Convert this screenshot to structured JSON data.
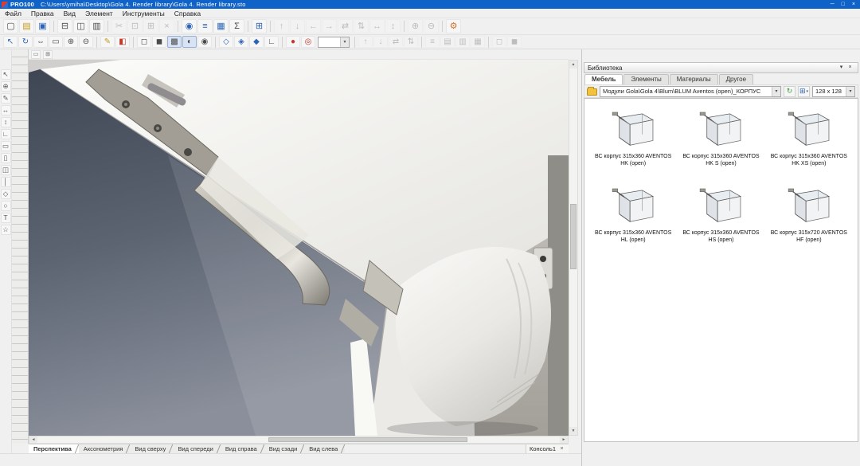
{
  "window": {
    "app_name": "PRO100",
    "file_path": "C:\\Users\\ymiha\\Desktop\\Gola 4. Render library\\Gola 4. Render library.sto",
    "minimize_glyph": "─",
    "maximize_glyph": "□",
    "close_glyph": "×"
  },
  "menu": {
    "items": [
      {
        "label": "Файл",
        "name": "menu-file"
      },
      {
        "label": "Правка",
        "name": "menu-edit"
      },
      {
        "label": "Вид",
        "name": "menu-view"
      },
      {
        "label": "Элемент",
        "name": "menu-element"
      },
      {
        "label": "Инструменты",
        "name": "menu-tools"
      },
      {
        "label": "Справка",
        "name": "menu-help"
      }
    ]
  },
  "toolbars": {
    "main": {
      "items": [
        {
          "name": "new-document-button",
          "glyph": "▢"
        },
        {
          "name": "open-button",
          "glyph": "▤",
          "cls": "c-yellow"
        },
        {
          "name": "save-button",
          "glyph": "▣",
          "cls": "c-blue"
        },
        {
          "name": "toolbar-separator",
          "cls": "sep",
          "interactable": false
        },
        {
          "name": "print-button",
          "glyph": "⊟"
        },
        {
          "name": "print-preview-button",
          "glyph": "◫"
        },
        {
          "name": "page-setup-button",
          "glyph": "▥"
        },
        {
          "name": "toolbar-separator",
          "cls": "sep",
          "interactable": false
        },
        {
          "name": "cut-button",
          "glyph": "✂",
          "cls": "disabled"
        },
        {
          "name": "copy-button",
          "glyph": "⊡",
          "cls": "disabled"
        },
        {
          "name": "paste-button",
          "glyph": "⊞",
          "cls": "disabled"
        },
        {
          "name": "delete-button",
          "glyph": "×",
          "cls": "disabled"
        },
        {
          "name": "toolbar-separator",
          "cls": "sep",
          "interactable": false
        },
        {
          "name": "update-library-button",
          "glyph": "◉",
          "cls": "c-blue"
        },
        {
          "name": "report-button",
          "glyph": "≡",
          "cls": "c-blue"
        },
        {
          "name": "price-list-button",
          "glyph": "▦",
          "cls": "c-blue"
        },
        {
          "name": "calculation-button",
          "glyph": "Σ"
        },
        {
          "name": "toolbar-separator",
          "cls": "sep",
          "interactable": false
        },
        {
          "name": "grid-button",
          "glyph": "⊞",
          "cls": "c-blue"
        },
        {
          "name": "toolbar-separator",
          "cls": "sep",
          "interactable": false
        },
        {
          "name": "align-top-button",
          "glyph": "↑",
          "cls": "disabled"
        },
        {
          "name": "align-bottom-button",
          "glyph": "↓",
          "cls": "disabled"
        },
        {
          "name": "align-left-button",
          "glyph": "←",
          "cls": "disabled"
        },
        {
          "name": "align-right-button",
          "glyph": "→",
          "cls": "disabled"
        },
        {
          "name": "center-horizontal-button",
          "glyph": "⇄",
          "cls": "disabled"
        },
        {
          "name": "center-vertical-button",
          "glyph": "⇅",
          "cls": "disabled"
        },
        {
          "name": "distribute-horizontal-button",
          "glyph": "↔",
          "cls": "disabled"
        },
        {
          "name": "distribute-vertical-button",
          "glyph": "↕",
          "cls": "disabled"
        },
        {
          "name": "toolbar-separator",
          "cls": "sep",
          "interactable": false
        },
        {
          "name": "group-button",
          "glyph": "⊕",
          "cls": "disabled"
        },
        {
          "name": "ungroup-button",
          "glyph": "⊖",
          "cls": "disabled"
        },
        {
          "name": "toolbar-separator",
          "cls": "sep",
          "interactable": false
        },
        {
          "name": "settings-button",
          "glyph": "⚙",
          "cls": "c-orange"
        }
      ]
    },
    "view": {
      "items_a": [
        {
          "name": "select-tool-button",
          "glyph": "↖",
          "cls": "c-blue"
        },
        {
          "name": "rotate-view-button",
          "glyph": "↻",
          "cls": "c-blue"
        },
        {
          "name": "pan-view-button",
          "glyph": "⇔"
        },
        {
          "name": "zoom-window-button",
          "glyph": "▭"
        },
        {
          "name": "zoom-in-button",
          "glyph": "⊕"
        },
        {
          "name": "zoom-out-button",
          "glyph": "⊖"
        },
        {
          "name": "toolbar-separator",
          "cls": "sep",
          "interactable": false
        },
        {
          "name": "edit-mode-button",
          "glyph": "✎",
          "cls": "c-yellow"
        },
        {
          "name": "material-mode-button",
          "glyph": "◧",
          "cls": "c-red"
        },
        {
          "name": "toolbar-separator",
          "cls": "sep",
          "interactable": false
        },
        {
          "name": "wireframe-mode-button",
          "glyph": "◻"
        },
        {
          "name": "solid-mode-button",
          "glyph": "◼"
        },
        {
          "name": "textured-mode-button",
          "glyph": "▩",
          "cls": "pressed"
        },
        {
          "name": "shadows-mode-button",
          "glyph": "◐",
          "cls": "pressed"
        },
        {
          "name": "visibility-button",
          "glyph": "◉"
        },
        {
          "name": "toolbar-separator",
          "cls": "sep",
          "interactable": false
        },
        {
          "name": "snap-grid-button",
          "glyph": "◇",
          "cls": "c-blue"
        },
        {
          "name": "snap-point-button",
          "glyph": "◈",
          "cls": "c-blue"
        },
        {
          "name": "snap-edge-button",
          "glyph": "◆",
          "cls": "c-blue"
        },
        {
          "name": "ortho-mode-button",
          "glyph": "∟"
        },
        {
          "name": "toolbar-separator",
          "cls": "sep",
          "interactable": false
        },
        {
          "name": "camera-button",
          "glyph": "●",
          "cls": "c-red"
        },
        {
          "name": "render-button",
          "glyph": "◎",
          "cls": "c-red"
        }
      ],
      "combobox": {
        "value": "",
        "arrow": "▾"
      },
      "items_b": [
        {
          "name": "toolbar-separator",
          "cls": "sep",
          "interactable": false
        },
        {
          "name": "move-up-button",
          "glyph": "↑",
          "cls": "disabled"
        },
        {
          "name": "move-down-button",
          "glyph": "↓",
          "cls": "disabled"
        },
        {
          "name": "flip-horizontal-button",
          "glyph": "⇄",
          "cls": "disabled"
        },
        {
          "name": "flip-vertical-button",
          "glyph": "⇅",
          "cls": "disabled"
        },
        {
          "name": "toolbar-separator",
          "cls": "sep",
          "interactable": false
        },
        {
          "name": "align-faces-button",
          "glyph": "≡",
          "cls": "disabled"
        },
        {
          "name": "fit-width-button",
          "glyph": "▤",
          "cls": "disabled"
        },
        {
          "name": "fit-height-button",
          "glyph": "▥",
          "cls": "disabled"
        },
        {
          "name": "fit-both-button",
          "glyph": "▦",
          "cls": "disabled"
        },
        {
          "name": "toolbar-separator",
          "cls": "sep",
          "interactable": false
        },
        {
          "name": "lock-button",
          "glyph": "◻",
          "cls": "disabled"
        },
        {
          "name": "unlock-button",
          "glyph": "◼",
          "cls": "disabled"
        }
      ]
    },
    "left": {
      "items": [
        {
          "name": "pointer-tool-button",
          "glyph": "↖"
        },
        {
          "name": "zoom-tool-button",
          "glyph": "⊕"
        },
        {
          "name": "pencil-tool-button",
          "glyph": "✎"
        },
        {
          "name": "dimension-horizontal-button",
          "glyph": "↔"
        },
        {
          "name": "dimension-vertical-button",
          "glyph": "↕"
        },
        {
          "name": "angle-tool-button",
          "glyph": "∟"
        },
        {
          "name": "wall-tool-button",
          "glyph": "▭"
        },
        {
          "name": "board-tool-button",
          "glyph": "▯"
        },
        {
          "name": "panel-tool-button",
          "glyph": "◫"
        },
        {
          "name": "rod-tool-button",
          "glyph": "│"
        },
        {
          "name": "shape-tool-button",
          "glyph": "◇"
        },
        {
          "name": "circle-tool-button",
          "glyph": "○"
        },
        {
          "name": "text-tool-button",
          "glyph": "T"
        },
        {
          "name": "star-tool-button",
          "glyph": "☆"
        }
      ]
    }
  },
  "viewport": {
    "mini_buttons": [
      {
        "name": "ruler-toggle-button",
        "glyph": "▭"
      },
      {
        "name": "guides-toggle-button",
        "glyph": "⊞"
      }
    ],
    "scrollbar": {
      "up": "▲",
      "down": "▼",
      "left": "◄",
      "right": "►"
    }
  },
  "view_tabs": {
    "items": [
      {
        "label": "Перспектива",
        "cls": "active",
        "name": "view-tab-perspective"
      },
      {
        "label": "Аксонометрия",
        "name": "view-tab-axonometry"
      },
      {
        "label": "Вид сверху",
        "name": "view-tab-top"
      },
      {
        "label": "Вид спереди",
        "name": "view-tab-front"
      },
      {
        "label": "Вид справа",
        "name": "view-tab-right"
      },
      {
        "label": "Вид сзади",
        "name": "view-tab-back"
      },
      {
        "label": "Вид слева",
        "name": "view-tab-left"
      }
    ],
    "console_tab": {
      "label": "Консоль1",
      "close_glyph": "×"
    }
  },
  "library": {
    "header": {
      "title": "Библиотека",
      "menu_glyph": "▾",
      "close_glyph": "×"
    },
    "tabs": [
      {
        "label": "Мебель",
        "cls": "active",
        "name": "library-tab-furniture"
      },
      {
        "label": "Элементы",
        "name": "library-tab-elements"
      },
      {
        "label": "Материалы",
        "name": "library-tab-materials"
      },
      {
        "label": "Другое",
        "name": "library-tab-other"
      }
    ],
    "toolbar": {
      "path": "Модули Gola\\Gola 4\\Blum\\BLUM Aventos (open)_КОРПУС",
      "path_arrow": "▾",
      "update_glyph": "↻",
      "view_glyph": "⊞",
      "view_arrow": "▾",
      "size": "128 x 128",
      "size_arrow": "▾"
    },
    "items": [
      {
        "name": "library-item",
        "label": "ВС корпус 315x360 AVENTOS HK (open)"
      },
      {
        "name": "library-item",
        "label": "ВС корпус 315x360 AVENTOS HK S (open)"
      },
      {
        "name": "library-item",
        "label": "ВС корпус 315x360 AVENTOS HK XS (open)"
      },
      {
        "name": "library-item",
        "label": "ВС корпус 315x360 AVENTOS HL (open)"
      },
      {
        "name": "library-item",
        "label": "ВС корпус 315x360 AVENTOS HS (open)"
      },
      {
        "name": "library-item",
        "label": "ВС корпус 315x720 AVENTOS HF (open)"
      }
    ]
  },
  "colors": {
    "titlebar": "#0f62c8",
    "chrome": "#f0f0f0",
    "wall_dark": "#3e4654",
    "panel_white": "#fbfbf9",
    "accent_blue": "#2e64b5"
  }
}
